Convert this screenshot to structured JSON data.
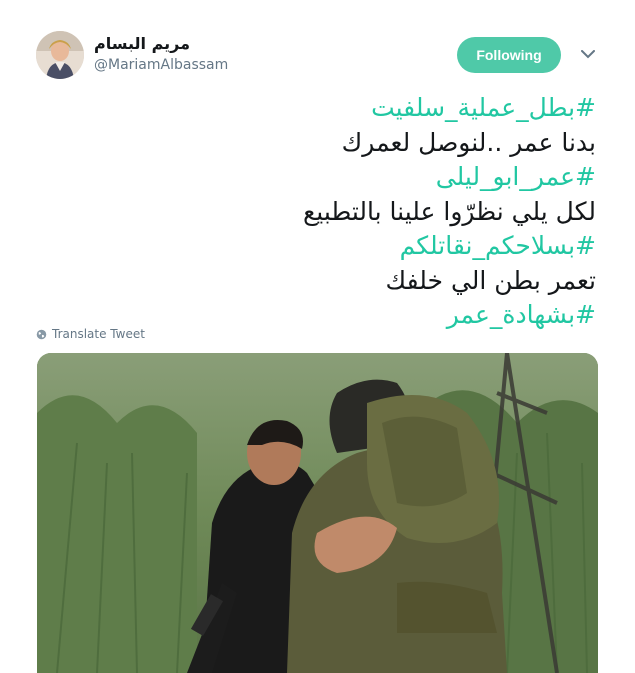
{
  "user": {
    "display_name": "مريم البسام",
    "handle": "@MariamAlbassam"
  },
  "follow_button": {
    "label": "Following"
  },
  "tweet": {
    "lines": [
      {
        "text": "#بطل_عملية_سلفيت",
        "type": "hashtag"
      },
      {
        "text": "بدنا عمر ..لنوصل لعمرك",
        "type": "text"
      },
      {
        "text": "#عمر_ابو_ليلى",
        "type": "hashtag"
      },
      {
        "text": "لكل يلي نظرّوا علينا بالتطبيع",
        "type": "text"
      },
      {
        "text": "#بسلاحكم_نقاتلكم",
        "type": "hashtag"
      },
      {
        "text": "تعمر بطن الي خلفك",
        "type": "text"
      },
      {
        "text": "#بشهادة_عمر",
        "type": "hashtag"
      }
    ]
  },
  "translate": {
    "label": "Translate Tweet",
    "icon": "globe-icon"
  },
  "colors": {
    "accent": "#21c7a2",
    "follow_bg": "#4fc9a8",
    "muted": "#657786"
  }
}
